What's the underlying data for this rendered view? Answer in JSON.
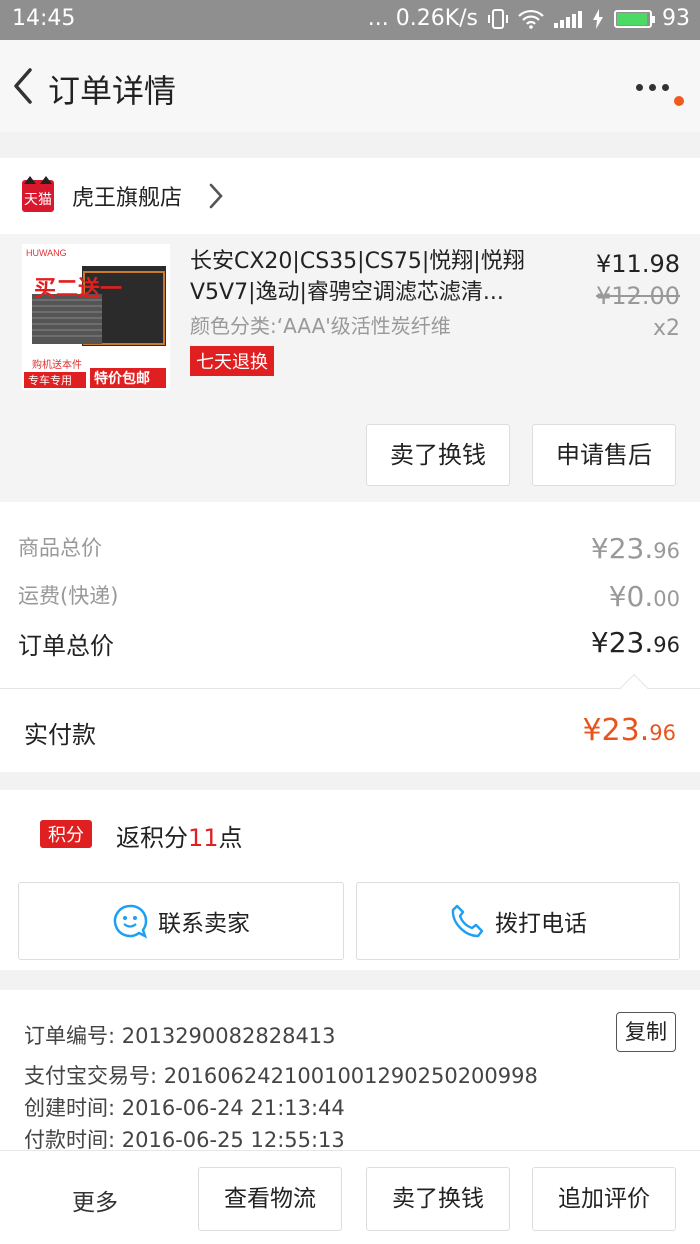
{
  "status_bar": {
    "time": "14:45",
    "network_speed": "... 0.26K/s",
    "battery_level": "93"
  },
  "header": {
    "title": "订单详情"
  },
  "shop": {
    "name": "虎王旗舰店",
    "platform_badge": "天猫"
  },
  "product": {
    "title": "长安CX20|CS35|CS75|悦翔|悦翔V5V7|逸动|睿骋空调滤芯滤清...",
    "spec": "颜色分类:‘AAA'级活性炭纤维",
    "return_badge": "七天退换",
    "price": "¥11.98",
    "original_price": "¥12.00",
    "quantity": "x2",
    "image_text": {
      "brand": "HUWANG",
      "promo1": "买二送一",
      "promo2": "特价包邮",
      "promo3": "专车专用",
      "promo4": "购机送本件"
    },
    "buttons": {
      "sell": "卖了换钱",
      "after_sales": "申请售后"
    }
  },
  "totals": {
    "goods_label": "商品总价",
    "goods_int": "¥23.",
    "goods_dec": "96",
    "shipping_label": "运费(快递)",
    "shipping_int": "¥0.",
    "shipping_dec": "00",
    "order_label": "订单总价",
    "order_int": "¥23.",
    "order_dec": "96"
  },
  "payment": {
    "label": "实付款",
    "int": "¥23.",
    "dec": "96"
  },
  "points": {
    "badge": "积分",
    "prefix": "返积分",
    "count": "11",
    "suffix": "点"
  },
  "contact": {
    "seller_label": "联系卖家",
    "call_label": "拨打电话"
  },
  "order_info": {
    "order_no": "订单编号: 2013290082828413",
    "alipay_no": "支付宝交易号: 2016062421001001290250200998",
    "created": "创建时间: 2016-06-24 21:13:44",
    "paid": "付款时间: 2016-06-25 12:55:13",
    "copy_label": "复制"
  },
  "bottom_bar": {
    "more": "更多",
    "logistics": "查看物流",
    "sell": "卖了换钱",
    "review": "追加评价"
  },
  "colors": {
    "accent_red": "#e02020",
    "pay_orange": "#e8541e",
    "battery_green": "#4cd964"
  }
}
